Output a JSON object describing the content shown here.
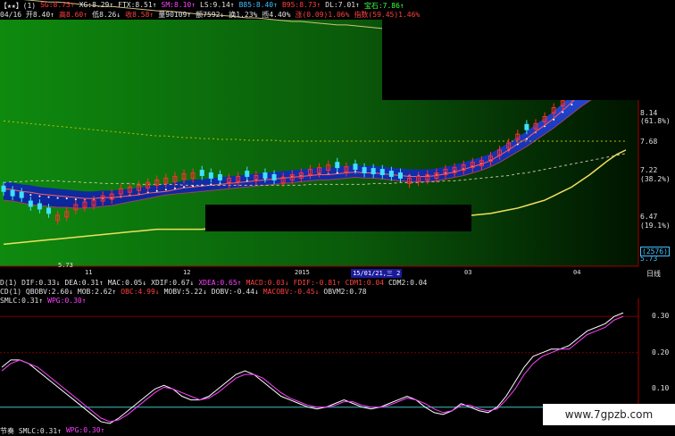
{
  "header_row1": [
    {
      "t": "【★★】(1)",
      "c": "#e0e0e0"
    },
    {
      "t": "SG:8.73↑",
      "c": "#ff4040"
    },
    {
      "t": "XG:8.29↑",
      "c": "#e0e0e0"
    },
    {
      "t": "FTX:8.51↑",
      "c": "#e0e0e0"
    },
    {
      "t": "SM:8.10↑",
      "c": "#ff40ff"
    },
    {
      "t": "LS:9.14↑",
      "c": "#e0e0e0"
    },
    {
      "t": "B85:8.40↑",
      "c": "#40c0ff"
    },
    {
      "t": "B95:8.73↑",
      "c": "#ff4040"
    },
    {
      "t": "DL:7.01↑",
      "c": "#e0e0e0"
    },
    {
      "t": "宝石:7.86↑",
      "c": "#40ff40"
    }
  ],
  "header_row2": [
    {
      "t": "04/16 开8.40↑",
      "c": "#e0e0e0"
    },
    {
      "t": "高8.60↑",
      "c": "#ff4040"
    },
    {
      "t": "低8.26↓",
      "c": "#e0e0e0"
    },
    {
      "t": "收8.58↑",
      "c": "#ff4040"
    },
    {
      "t": "量90109↑",
      "c": "#e0e0e0"
    },
    {
      "t": "额7592↓",
      "c": "#e0e0e0"
    },
    {
      "t": "换1.23%",
      "c": "#e0e0e0"
    },
    {
      "t": "揯4.40%",
      "c": "#e0e0e0"
    },
    {
      "t": "涨(0.09)1.06%",
      "c": "#ff4040"
    },
    {
      "t": "指数(59.45)1.46%",
      "c": "#ff4040"
    }
  ],
  "main_chart": {
    "price_labels": [
      "8.14",
      "(61.8%)",
      "7.68",
      "7.22",
      "(38.2%)",
      "6.47",
      "(19.1%)",
      "(2576)",
      "5.73"
    ],
    "low_marker": "5.73",
    "x_labels": [
      "11",
      "12",
      "2015",
      "03",
      "04"
    ],
    "cursor_date": "15/01/21,三",
    "cursor_value": "2",
    "period_label": "日线"
  },
  "macd_row": [
    {
      "t": "D(1) DIF:0.33↓",
      "c": "#e0e0e0"
    },
    {
      "t": "DEA:0.31↑",
      "c": "#e0e0e0"
    },
    {
      "t": "MAC:0.05↓",
      "c": "#e0e0e0"
    },
    {
      "t": "XDIF:0.67↓",
      "c": "#e0e0e0"
    },
    {
      "t": "XDEA:0.65↑",
      "c": "#ff40ff"
    },
    {
      "t": "MACD:0.03↓",
      "c": "#ff4040"
    },
    {
      "t": "FDIF:-0.81↑",
      "c": "#ff4040"
    },
    {
      "t": "CDM1:0.04",
      "c": "#ff4040"
    },
    {
      "t": "CDM2:0.04",
      "c": "#e0e0e0"
    }
  ],
  "obv_row": [
    {
      "t": "CD(1) QBOBV:2.60↓",
      "c": "#e0e0e0"
    },
    {
      "t": "MOB:2.62↑",
      "c": "#e0e0e0"
    },
    {
      "t": "OBC:4.99↓",
      "c": "#ff4040"
    },
    {
      "t": "MOBV:5.22↓",
      "c": "#e0e0e0"
    },
    {
      "t": "DOBV:-0.44↓",
      "c": "#e0e0e0"
    },
    {
      "t": "MACOBV:-0.45↓",
      "c": "#ff4040"
    },
    {
      "t": "OBVM2:0.78",
      "c": "#e0e0e0"
    }
  ],
  "osc_header": [
    {
      "t": "SMLC:0.31↑",
      "c": "#e0e0e0"
    },
    {
      "t": "WPG:0.30↑",
      "c": "#ff40ff"
    }
  ],
  "osc_footer": [
    {
      "t": "节奏 SMLC:0.31↑",
      "c": "#e0e0e0"
    },
    {
      "t": "WPG:0.30↑",
      "c": "#ff40ff"
    }
  ],
  "osc_labels": [
    "0.30",
    "0.20",
    "0.10"
  ],
  "watermark": "www.7gpzb.com",
  "chart_data": [
    {
      "type": "line",
      "x": [
        0,
        1,
        2,
        3,
        4,
        5,
        6,
        7,
        8,
        9,
        10,
        11,
        12,
        13,
        14,
        15,
        16,
        17,
        18,
        19,
        20,
        21,
        22,
        23,
        24,
        25,
        26,
        27,
        28,
        29,
        30,
        31,
        32,
        33,
        34,
        35,
        36,
        37,
        38,
        39,
        40,
        41,
        42,
        43,
        44,
        45,
        46,
        47,
        48,
        49,
        50,
        51,
        52,
        53,
        54,
        55,
        56,
        57,
        58,
        59,
        60,
        61,
        62,
        63,
        64,
        65,
        66,
        67,
        68,
        69
      ],
      "ylim": [
        5.6,
        8.4
      ],
      "series": [
        {
          "values": [
            6.48,
            6.47,
            6.45,
            6.44,
            6.42,
            6.41,
            6.4,
            6.39,
            6.38,
            6.37,
            6.37,
            6.38,
            6.38,
            6.39,
            6.4,
            6.41,
            6.43,
            6.44,
            6.45,
            6.47,
            6.49,
            6.5,
            6.51,
            6.52,
            6.53,
            6.54,
            6.55,
            6.56,
            6.57,
            6.58,
            6.59,
            6.6,
            6.61,
            6.62,
            6.63,
            6.64,
            6.64,
            6.65,
            6.66,
            6.67,
            6.66,
            6.66,
            6.65,
            6.64,
            6.63,
            6.62,
            6.62,
            6.62,
            6.63,
            6.65,
            6.67,
            6.7,
            6.73,
            6.76,
            6.8,
            6.86,
            6.92,
            6.99,
            7.05,
            7.13,
            7.2,
            7.28,
            7.37,
            7.46,
            7.56,
            7.66,
            7.74,
            7.81,
            7.85,
            7.88
          ]
        },
        {
          "values": [
            6.35,
            6.34,
            6.32,
            6.3,
            6.29,
            6.28,
            6.27,
            6.27,
            6.26,
            6.26,
            6.27,
            6.28,
            6.29,
            6.31,
            6.33,
            6.35,
            6.37,
            6.39,
            6.41,
            6.42,
            6.43,
            6.44,
            6.45,
            6.46,
            6.47,
            6.48,
            6.49,
            6.5,
            6.51,
            6.52,
            6.53,
            6.54,
            6.55,
            6.56,
            6.57,
            6.58,
            6.58,
            6.59,
            6.6,
            6.61,
            6.6,
            6.6,
            6.59,
            6.58,
            6.57,
            6.56,
            6.56,
            6.56,
            6.57,
            6.59,
            6.61,
            6.63,
            6.66,
            6.69,
            6.73,
            6.78,
            6.84,
            6.9,
            6.96,
            7.03,
            7.1,
            7.17,
            7.25,
            7.33,
            7.41,
            7.48,
            7.54,
            7.59,
            7.62,
            7.64
          ]
        },
        {
          "values": [
            5.85,
            5.86,
            5.87,
            5.88,
            5.89,
            5.9,
            5.91,
            5.92,
            5.93,
            5.94,
            5.95,
            5.96,
            5.97,
            5.98,
            5.99,
            6.0,
            6.01,
            6.02,
            6.02,
            6.02,
            6.02,
            6.02,
            6.02,
            6.03,
            6.03,
            6.03,
            6.03,
            6.03,
            6.03,
            6.04,
            6.04,
            6.04,
            6.04,
            6.05,
            6.05,
            6.05,
            6.06,
            6.06,
            6.07,
            6.08,
            6.09,
            6.1,
            6.1,
            6.11,
            6.11,
            6.12,
            6.12,
            6.13,
            6.14,
            6.15,
            6.16,
            6.17,
            6.18,
            6.19,
            6.2,
            6.22,
            6.24,
            6.26,
            6.29,
            6.32,
            6.35,
            6.4,
            6.45,
            6.5,
            6.57,
            6.64,
            6.72,
            6.8,
            6.87,
            6.92
          ]
        },
        {
          "values": [
            6.55,
            6.56,
            6.56,
            6.57,
            6.57,
            6.57,
            6.57,
            6.56,
            6.56,
            6.55,
            6.55,
            6.54,
            6.54,
            6.54,
            6.54,
            6.53,
            6.53,
            6.53,
            6.53,
            6.53,
            6.52,
            6.52,
            6.52,
            6.52,
            6.52,
            6.52,
            6.52,
            6.52,
            6.52,
            6.52,
            6.52,
            6.52,
            6.52,
            6.52,
            6.53,
            6.53,
            6.53,
            6.53,
            6.53,
            6.53,
            6.53,
            6.54,
            6.54,
            6.54,
            6.55,
            6.55,
            6.55,
            6.56,
            6.56,
            6.57,
            6.57,
            6.58,
            6.59,
            6.6,
            6.61,
            6.62,
            6.63,
            6.65,
            6.66,
            6.68,
            6.7,
            6.72,
            6.74,
            6.76,
            6.78,
            6.8,
            6.82,
            6.84,
            6.86,
            6.88
          ]
        },
        {
          "values": [
            7.25,
            7.24,
            7.23,
            7.22,
            7.21,
            7.2,
            7.19,
            7.18,
            7.17,
            7.16,
            7.15,
            7.14,
            7.13,
            7.12,
            7.11,
            7.1,
            7.09,
            7.08,
            7.08,
            7.07,
            7.06,
            7.06,
            7.05,
            7.05,
            7.04,
            7.04,
            7.04,
            7.03,
            7.03,
            7.03,
            7.03,
            7.02,
            7.02,
            7.02,
            7.02,
            7.02,
            7.02,
            7.02,
            7.02,
            7.02,
            7.02,
            7.02,
            7.02,
            7.02,
            7.02,
            7.02,
            7.02,
            7.02,
            7.02,
            7.02,
            7.02,
            7.02,
            7.02,
            7.02,
            7.02,
            7.02,
            7.02,
            7.02,
            7.02,
            7.02,
            7.02,
            7.02,
            7.02,
            7.02,
            7.02,
            7.02,
            7.02,
            7.02,
            7.02,
            7.02
          ]
        },
        {
          "values": [
            8.65,
            8.64,
            8.63,
            8.62,
            8.61,
            8.6,
            8.6,
            8.59,
            8.58,
            8.57,
            8.56,
            8.55,
            8.55,
            8.54,
            8.53,
            8.52,
            8.51,
            8.5,
            8.5,
            8.49,
            8.48,
            8.47,
            8.46,
            8.46,
            8.45,
            8.44,
            8.43,
            8.42,
            8.42,
            8.41,
            8.4,
            8.39,
            8.38,
            8.38,
            8.37,
            8.36,
            8.35,
            8.34,
            8.34,
            8.33,
            8.32,
            8.31,
            8.3,
            8.3,
            8.29,
            8.28,
            8.27,
            8.26,
            8.26,
            8.25,
            8.24,
            8.23,
            8.22,
            8.22,
            8.21,
            8.2,
            8.19,
            8.18,
            8.18,
            8.17,
            8.16,
            8.15,
            8.14,
            8.14,
            8.13,
            8.12,
            8.11,
            8.1,
            8.1,
            8.09
          ]
        }
      ],
      "candles_close": [
        6.45,
        6.4,
        6.38,
        6.28,
        6.25,
        6.2,
        6.18,
        6.22,
        6.3,
        6.33,
        6.35,
        6.4,
        6.42,
        6.48,
        6.5,
        6.52,
        6.55,
        6.58,
        6.6,
        6.62,
        6.65,
        6.66,
        6.63,
        6.6,
        6.58,
        6.6,
        6.62,
        6.62,
        6.63,
        6.6,
        6.58,
        6.61,
        6.64,
        6.66,
        6.7,
        6.72,
        6.75,
        6.72,
        6.73,
        6.7,
        6.66,
        6.65,
        6.64,
        6.62,
        6.6,
        6.6,
        6.62,
        6.64,
        6.66,
        6.7,
        6.72,
        6.75,
        6.78,
        6.8,
        6.85,
        6.92,
        7.0,
        7.1,
        7.15,
        7.22,
        7.3,
        7.4,
        7.48,
        7.58,
        7.7,
        7.8,
        7.9,
        8.0,
        8.1,
        8.14
      ],
      "candles_up": [
        0,
        0,
        0,
        0,
        0,
        0,
        1,
        1,
        1,
        1,
        1,
        1,
        1,
        1,
        1,
        1,
        1,
        1,
        1,
        1,
        1,
        1,
        0,
        0,
        0,
        1,
        1,
        0,
        1,
        0,
        0,
        1,
        1,
        1,
        1,
        1,
        1,
        0,
        1,
        0,
        0,
        0,
        0,
        0,
        0,
        1,
        1,
        1,
        1,
        1,
        1,
        1,
        1,
        1,
        1,
        1,
        1,
        1,
        0,
        1,
        1,
        1,
        1,
        1,
        1,
        1,
        1,
        1,
        1,
        1
      ]
    },
    {
      "type": "line",
      "x": [
        0,
        1,
        2,
        3,
        4,
        5,
        6,
        7,
        8,
        9,
        10,
        11,
        12,
        13,
        14,
        15,
        16,
        17,
        18,
        19,
        20,
        21,
        22,
        23,
        24,
        25,
        26,
        27,
        28,
        29,
        30,
        31,
        32,
        33,
        34,
        35,
        36,
        37,
        38,
        39,
        40,
        41,
        42,
        43,
        44,
        45,
        46,
        47,
        48,
        49,
        50,
        51,
        52,
        53,
        54,
        55,
        56,
        57,
        58,
        59,
        60,
        61,
        62,
        63,
        64,
        65,
        66,
        67,
        68,
        69
      ],
      "ylim": [
        0.0,
        0.33
      ],
      "series": [
        {
          "name": "SMLC",
          "values": [
            0.16,
            0.18,
            0.18,
            0.17,
            0.15,
            0.13,
            0.11,
            0.09,
            0.07,
            0.05,
            0.03,
            0.01,
            0.005,
            0.02,
            0.04,
            0.06,
            0.08,
            0.1,
            0.11,
            0.1,
            0.08,
            0.07,
            0.07,
            0.08,
            0.1,
            0.12,
            0.14,
            0.15,
            0.14,
            0.12,
            0.1,
            0.08,
            0.07,
            0.06,
            0.05,
            0.045,
            0.05,
            0.06,
            0.07,
            0.06,
            0.05,
            0.045,
            0.05,
            0.06,
            0.07,
            0.08,
            0.07,
            0.05,
            0.035,
            0.03,
            0.04,
            0.06,
            0.05,
            0.04,
            0.035,
            0.05,
            0.08,
            0.12,
            0.16,
            0.19,
            0.2,
            0.21,
            0.21,
            0.22,
            0.24,
            0.26,
            0.27,
            0.28,
            0.3,
            0.31
          ]
        },
        {
          "name": "WPG",
          "values": [
            0.15,
            0.17,
            0.18,
            0.17,
            0.16,
            0.14,
            0.12,
            0.1,
            0.08,
            0.06,
            0.04,
            0.02,
            0.01,
            0.015,
            0.03,
            0.05,
            0.07,
            0.09,
            0.105,
            0.1,
            0.09,
            0.08,
            0.07,
            0.075,
            0.09,
            0.11,
            0.13,
            0.14,
            0.14,
            0.13,
            0.11,
            0.09,
            0.075,
            0.065,
            0.055,
            0.05,
            0.05,
            0.055,
            0.065,
            0.065,
            0.055,
            0.05,
            0.05,
            0.055,
            0.065,
            0.075,
            0.07,
            0.06,
            0.045,
            0.035,
            0.04,
            0.055,
            0.055,
            0.045,
            0.04,
            0.045,
            0.07,
            0.1,
            0.14,
            0.17,
            0.19,
            0.2,
            0.21,
            0.21,
            0.23,
            0.25,
            0.26,
            0.27,
            0.29,
            0.3
          ]
        }
      ],
      "reference": 0.05
    }
  ]
}
